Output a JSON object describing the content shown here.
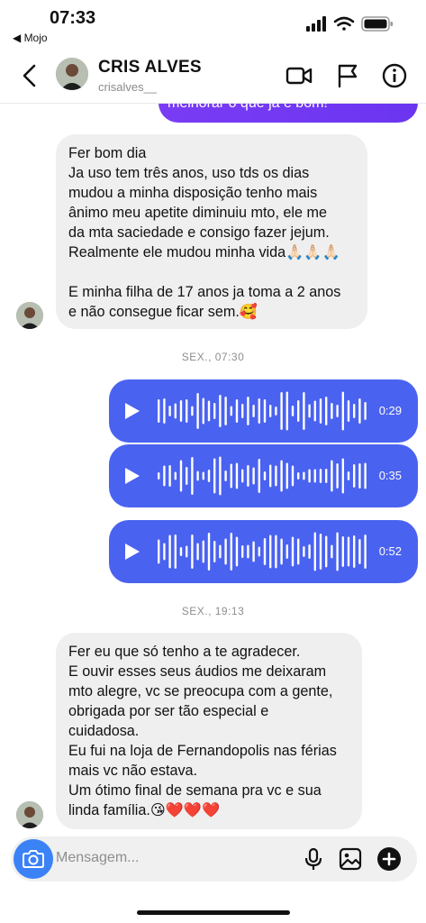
{
  "status_bar": {
    "time": "07:33",
    "back_app": "◀ Mojo"
  },
  "header": {
    "name": "CRIS ALVES",
    "username": "crisalves__"
  },
  "top_outgoing_text": "melhorar o que já é bom!",
  "message1": {
    "lines": [
      "Fer bom dia",
      "Ja uso tem três anos, uso tds os dias",
      "mudou a minha disposição tenho mais",
      "ânimo meu apetite diminuiu mto, ele me",
      "da mta saciedade e consigo fazer jejum.",
      "Realmente ele mudou minha vida🙏🏻🙏🏻🙏🏻",
      "",
      "E minha filha de 17 anos ja toma a 2 anos",
      "e não consegue ficar sem.🥰"
    ]
  },
  "timestamp1": "SEX., 07:30",
  "audios": [
    {
      "duration": "0:29"
    },
    {
      "duration": "0:35"
    },
    {
      "duration": "0:52"
    }
  ],
  "timestamp2": "SEX., 19:13",
  "message2": {
    "lines": [
      "Fer eu que só tenho a te agradecer.",
      "E ouvir esses seus áudios me deixaram",
      "mto alegre, vc se preocupa com a gente,",
      "obrigada por ser tão especial e",
      "cuidadosa.",
      "Eu fui na loja de Fernandopolis nas férias",
      "mais vc não estava.",
      "Um ótimo final de semana pra vc e sua",
      "linda família.😘❤️❤️❤️"
    ]
  },
  "composer": {
    "placeholder": "Mensagem..."
  },
  "colors": {
    "outgoing": "#7a3cf5",
    "audio": "#4a62f0",
    "incoming": "#efefef"
  }
}
